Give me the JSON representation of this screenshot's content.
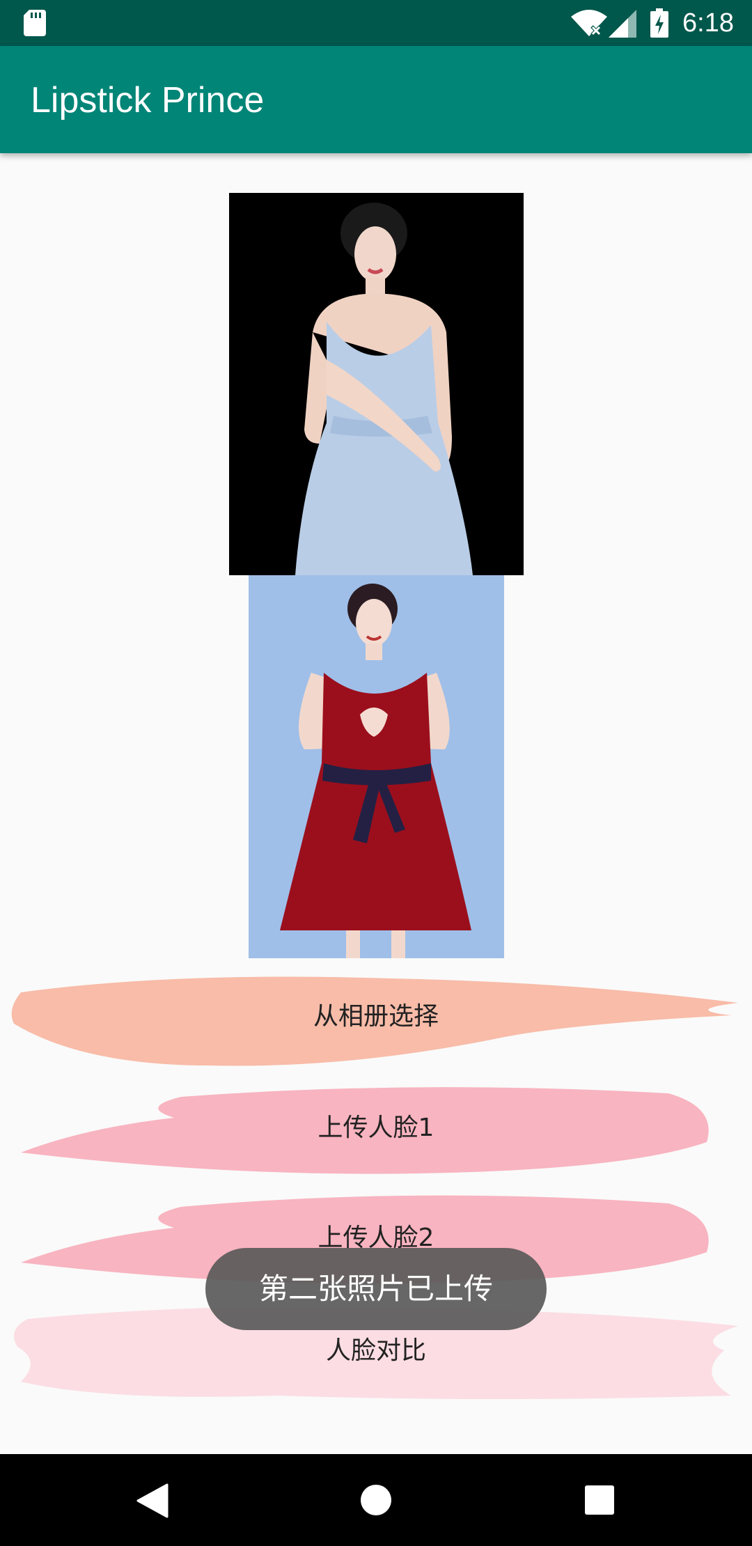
{
  "status_bar": {
    "time": "6:18",
    "icons": [
      "sd-card-icon",
      "wifi-no-internet-icon",
      "cell-signal-icon",
      "battery-charging-icon"
    ]
  },
  "app_bar": {
    "title": "Lipstick Prince",
    "color": "#008577",
    "status_color": "#00574b"
  },
  "photos": [
    {
      "name": "face-photo-1",
      "description_icon": "woman-in-blue-dress-photo"
    },
    {
      "name": "face-photo-2",
      "description_icon": "woman-in-red-dress-photo"
    }
  ],
  "buttons": {
    "choose_from_album": "从相册选择",
    "upload_face_1": "上传人脸1",
    "upload_face_2": "上传人脸2",
    "compare_faces": "人脸对比"
  },
  "brush_colors": {
    "album": "#f8bca8",
    "upload1": "#f8b4c0",
    "upload2": "#f8b4c0",
    "compare": "#fbdde3"
  },
  "toast": {
    "message": "第二张照片已上传"
  },
  "nav_bar": {
    "icons": [
      "back-icon",
      "home-icon",
      "recents-icon"
    ]
  }
}
